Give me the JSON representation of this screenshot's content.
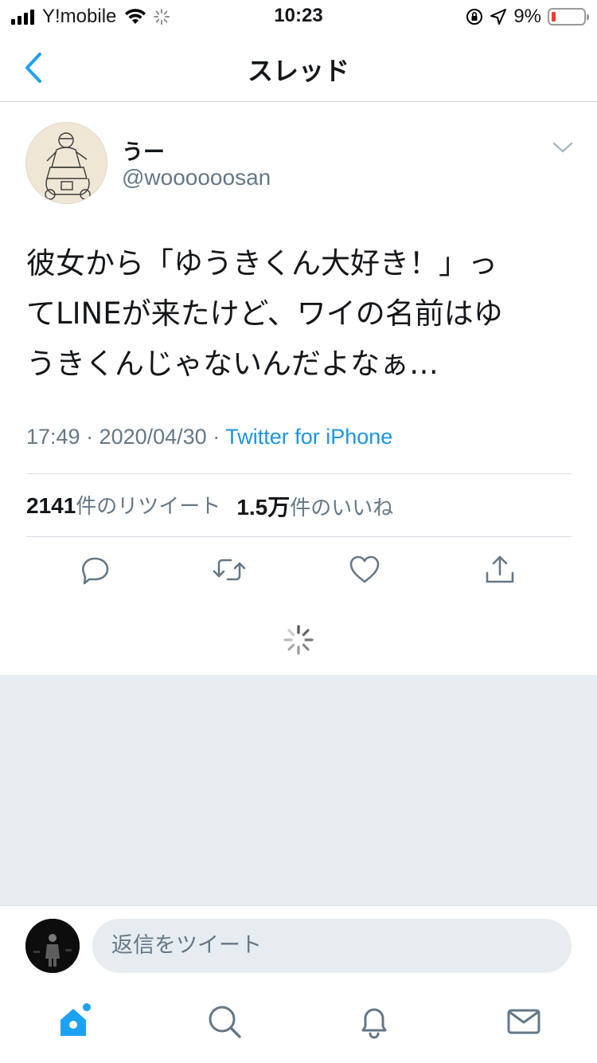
{
  "status_bar": {
    "carrier": "Y!mobile",
    "time": "10:23",
    "battery_percent": "9%",
    "battery_level": 0.09
  },
  "nav": {
    "title": "スレッド"
  },
  "tweet": {
    "display_name": "うー",
    "handle": "@woooooosan",
    "text_lines": [
      "彼女から「ゆうきくん大好き！」っ",
      "てLINEが来たけど、ワイの名前はゆ",
      "うきくんじゃないんだよなぁ…"
    ],
    "timestamp": "17:49 · 2020/04/30 · ",
    "source": "Twitter for iPhone",
    "retweet_count": "2141",
    "retweet_label": "件のリツイート",
    "like_count": "1.5万",
    "like_label": "件のいいね"
  },
  "reply": {
    "placeholder": "返信をツイート"
  },
  "colors": {
    "accent": "#1da1f2",
    "link": "#1b95e0",
    "secondary_text": "#657786",
    "gray_background": "#e6ecf0"
  },
  "icons": {
    "actions": [
      "reply-icon",
      "retweet-icon",
      "like-icon",
      "share-icon"
    ],
    "tabs": [
      "home-icon",
      "search-icon",
      "notifications-icon",
      "messages-icon"
    ]
  }
}
